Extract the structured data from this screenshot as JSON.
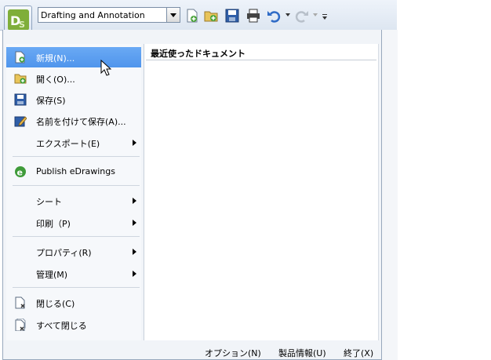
{
  "toolbar": {
    "workspace_value": "Drafting and Annotation",
    "icons": [
      "new-icon",
      "open-icon",
      "save-icon",
      "print-icon",
      "undo-icon",
      "redo-icon",
      "customize-icon"
    ]
  },
  "menu": {
    "items": [
      {
        "label": "新規(N)...",
        "icon": "new-document-icon",
        "highlighted": true,
        "submenu": false
      },
      {
        "label": "開く(O)...",
        "icon": "open-folder-icon",
        "highlighted": false,
        "submenu": false
      },
      {
        "label": "保存(S)",
        "icon": "save-icon",
        "highlighted": false,
        "submenu": false
      },
      {
        "label": "名前を付けて保存(A)...",
        "icon": "save-as-icon",
        "highlighted": false,
        "submenu": false
      },
      {
        "label": "エクスポート(E)",
        "icon": "",
        "highlighted": false,
        "submenu": true
      },
      {
        "label": "Publish eDrawings",
        "icon": "edrawings-icon",
        "highlighted": false,
        "submenu": false
      },
      {
        "label": "シート",
        "icon": "",
        "highlighted": false,
        "submenu": true
      },
      {
        "label": "印刷（P)",
        "icon": "",
        "highlighted": false,
        "submenu": true
      },
      {
        "label": "プロパティ(R)",
        "icon": "",
        "highlighted": false,
        "submenu": true
      },
      {
        "label": "管理(M)",
        "icon": "",
        "highlighted": false,
        "submenu": true
      },
      {
        "label": "閉じる(C)",
        "icon": "close-document-icon",
        "highlighted": false,
        "submenu": false
      },
      {
        "label": "すべて閉じる",
        "icon": "close-all-icon",
        "highlighted": false,
        "submenu": false
      }
    ],
    "recent_header": "最近使ったドキュメント",
    "footer": {
      "options": "オプション(N)",
      "product_info": "製品情報(U)",
      "exit": "終了(X)"
    }
  },
  "colors": {
    "highlight": "#5a9ff0",
    "menu_bg": "#f1f4f8"
  }
}
